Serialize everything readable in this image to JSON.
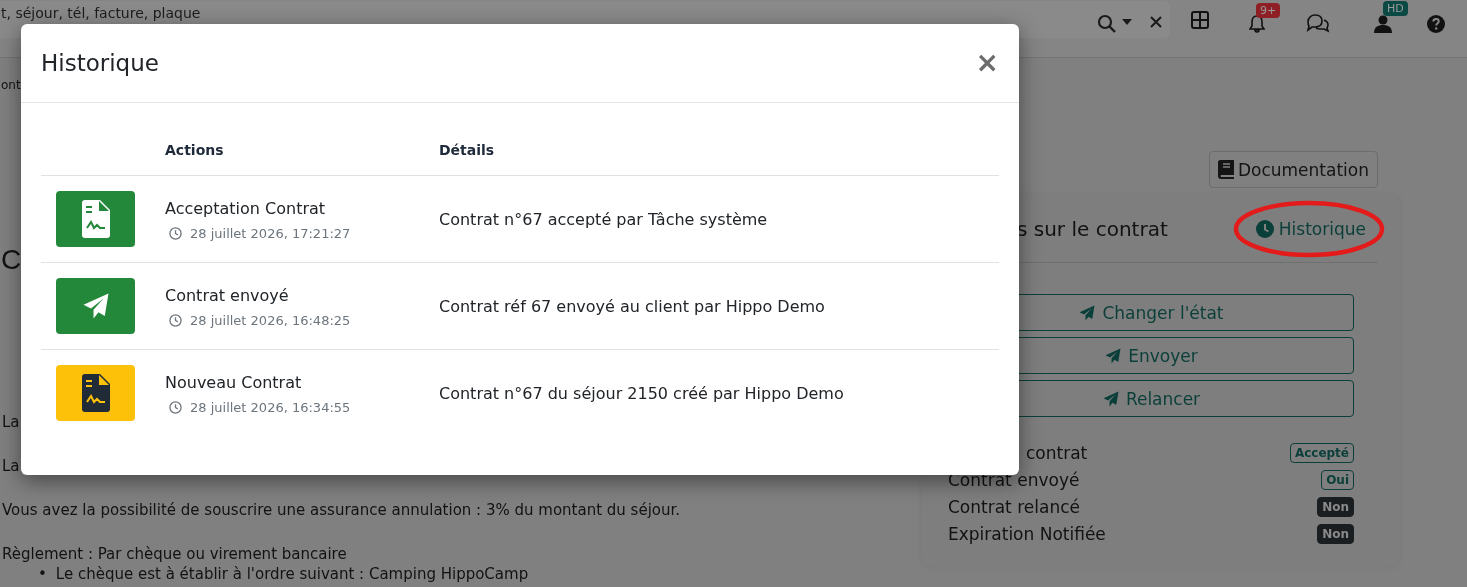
{
  "topbar": {
    "search": {
      "placeholder": "t, séjour, tél, facture, plaque"
    },
    "notifications_badge": "9+",
    "user_badge": "HD"
  },
  "page": {
    "breadcrumb": "ont",
    "heading": "C",
    "paragraphs": [
      "La",
      "La",
      "Vous avez la possibilité de souscrire une assurance annulation : 3% du montant du séjour.",
      "Règlement : Par chèque ou virement bancaire"
    ],
    "bullets": [
      {
        "marker": "•",
        "text": "Le chèque est à établir à l'ordre suivant : Camping HippoCamp"
      }
    ]
  },
  "sidebar": {
    "documentation_button": "Documentation",
    "card": {
      "title": "s sur le contrat",
      "history_link": "Historique",
      "history_link_highlighted": true,
      "actions": [
        "Changer l'état",
        "Envoyer",
        "Relancer"
      ],
      "statuses": [
        {
          "label": "contrat",
          "value": "Accepté",
          "kind": "outline"
        },
        {
          "label": "Contrat envoyé",
          "value": "Oui",
          "kind": "outline"
        },
        {
          "label": "Contrat relancé",
          "value": "Non",
          "kind": "dark"
        },
        {
          "label": "Expiration Notifiée",
          "value": "Non",
          "kind": "dark"
        }
      ]
    }
  },
  "modal": {
    "title": "Historique",
    "close": "×",
    "columns": [
      "Actions",
      "Détails"
    ],
    "rows": [
      {
        "kind": "accepted",
        "action": "Acceptation Contrat",
        "time": "28 juillet 2026, 17:21:27",
        "details": "Contrat n°67 accepté par Tâche système"
      },
      {
        "kind": "sent",
        "action": "Contrat envoyé",
        "time": "28 juillet 2026, 16:48:25",
        "details": "Contrat réf 67 envoyé au client par Hippo Demo"
      },
      {
        "kind": "new",
        "action": "Nouveau Contrat",
        "time": "28 juillet 2026, 16:34:55",
        "details": "Contrat n°67 du séjour 2150 créé par Hippo Demo"
      }
    ]
  }
}
